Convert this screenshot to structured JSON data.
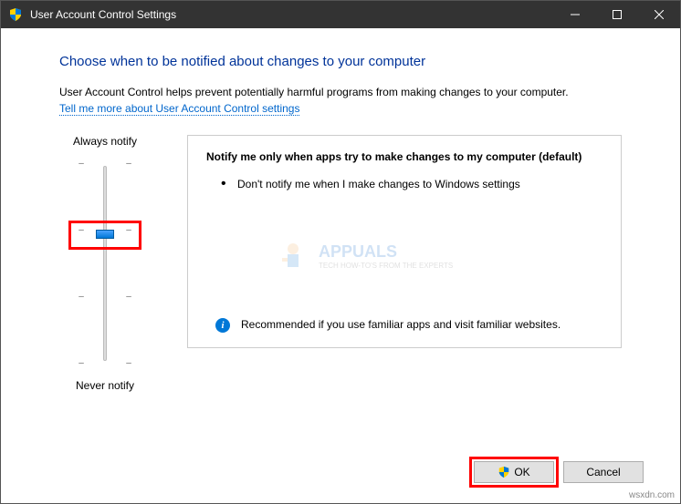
{
  "titlebar": {
    "title": "User Account Control Settings"
  },
  "content": {
    "heading": "Choose when to be notified about changes to your computer",
    "description": "User Account Control helps prevent potentially harmful programs from making changes to your computer.",
    "link": "Tell me more about User Account Control settings"
  },
  "slider": {
    "top_label": "Always notify",
    "bottom_label": "Never notify",
    "levels": 4,
    "current_level": 2
  },
  "panel": {
    "title": "Notify me only when apps try to make changes to my computer (default)",
    "bullet": "Don't notify me when I make changes to Windows settings",
    "recommendation": "Recommended if you use familiar apps and visit familiar websites."
  },
  "buttons": {
    "ok": "OK",
    "cancel": "Cancel"
  },
  "watermark": {
    "name": "APPUALS",
    "tagline": "TECH HOW-TO'S FROM THE EXPERTS"
  },
  "attribution": "wsxdn.com"
}
